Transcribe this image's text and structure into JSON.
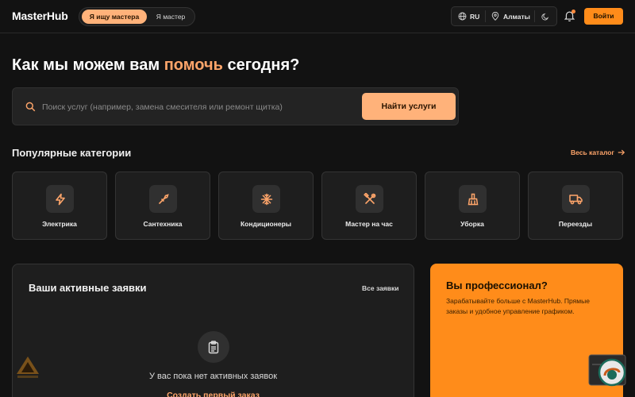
{
  "header": {
    "logo": "MasterHub",
    "role_active": "Я ищу мастера",
    "role_inactive": "Я мастер",
    "language": "RU",
    "city": "Алматы",
    "login": "Войти"
  },
  "hero": {
    "title_before": "Как мы можем вам ",
    "title_accent": "помочь",
    "title_after": " сегодня?"
  },
  "search": {
    "placeholder": "Поиск услуг (например, замена смесителя или ремонт щитка)",
    "button": "Найти услуги"
  },
  "categories": {
    "title": "Популярные категории",
    "catalog_link": "Весь каталог",
    "items": [
      {
        "label": "Электрика",
        "icon": "bolt-icon"
      },
      {
        "label": "Сантехника",
        "icon": "wrench-icon"
      },
      {
        "label": "Кондиционеры",
        "icon": "snowflake-icon"
      },
      {
        "label": "Мастер на час",
        "icon": "tools-icon"
      },
      {
        "label": "Уборка",
        "icon": "broom-icon"
      },
      {
        "label": "Переезды",
        "icon": "truck-icon"
      }
    ]
  },
  "requests": {
    "title": "Ваши активные заявки",
    "all_link": "Все заявки",
    "empty_text": "У вас пока нет активных заявок",
    "create_link": "Создать первый заказ"
  },
  "pro": {
    "title": "Вы профессионал?",
    "text": "Зарабатывайте больше с MasterHub. Прямые заказы и удобное управление графиком."
  },
  "colors": {
    "accent": "#ff8c1a",
    "accent_light": "#ffb27a",
    "background": "#121212"
  }
}
